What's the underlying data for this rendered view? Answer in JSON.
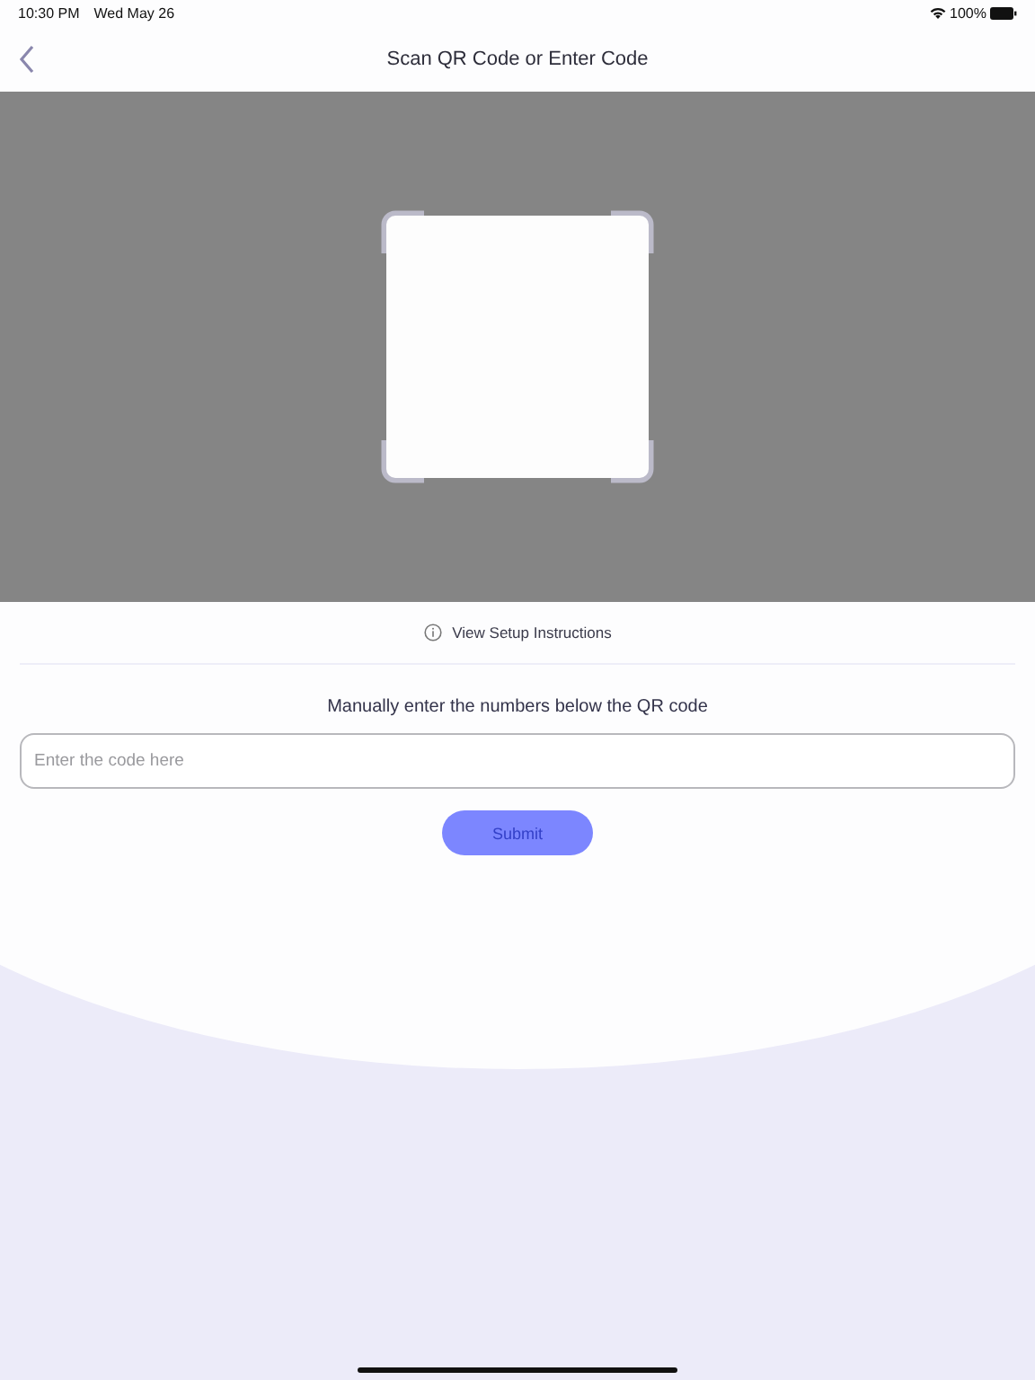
{
  "status_bar": {
    "time": "10:30 PM",
    "date": "Wed May 26",
    "battery": "100%"
  },
  "nav": {
    "title": "Scan QR Code or Enter Code"
  },
  "setup_link": "View Setup Instructions",
  "manual": {
    "instruction": "Manually enter the numbers below the QR code",
    "placeholder": "Enter the code here",
    "submit": {
      "label": "Submit",
      "disabled": true
    }
  }
}
